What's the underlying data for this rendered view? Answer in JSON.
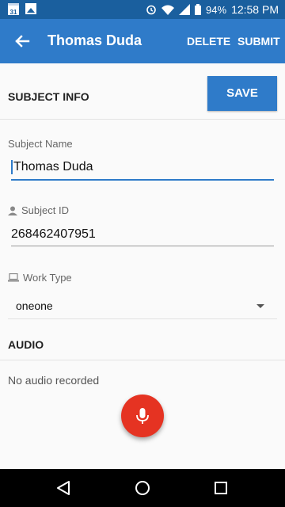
{
  "status_bar": {
    "battery": "94%",
    "time": "12:58 PM",
    "calendar_day": "31"
  },
  "app_bar": {
    "title": "Thomas Duda",
    "delete_label": "DELETE",
    "submit_label": "SUBMIT"
  },
  "subject_info": {
    "header": "SUBJECT INFO",
    "save_label": "SAVE",
    "name_label": "Subject Name",
    "name_value": "Thomas Duda",
    "id_label": "Subject ID",
    "id_value": "268462407951",
    "work_type_label": "Work Type",
    "work_type_value": "oneone"
  },
  "audio": {
    "header": "AUDIO",
    "status": "No audio recorded"
  },
  "colors": {
    "primary": "#2f7bc9",
    "status_bar": "#1a5f9e",
    "record": "#e53322"
  }
}
